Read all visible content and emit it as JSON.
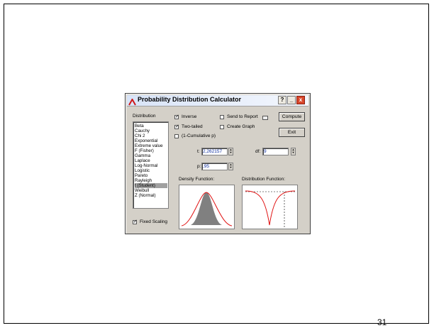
{
  "window": {
    "title": "Probability Distribution Calculator",
    "help": "?",
    "minimize": "_",
    "close": "x"
  },
  "distribution": {
    "label": "Distribution",
    "items": [
      "Beta",
      "Cauchy",
      "Chi 2",
      "Exponential",
      "Extreme value",
      "F (Fisher)",
      "Gamma",
      "Laplace",
      "Log-Normal",
      "Logistic",
      "Pareto",
      "Rayleigh",
      "t (Student)",
      "Weibull",
      "Z (Normal)"
    ],
    "selected": "t (Student)"
  },
  "options": {
    "inverse": {
      "label": "Inverse",
      "checked": true
    },
    "two_tailed": {
      "label": "Two-tailed",
      "checked": true
    },
    "cumulative": {
      "label": "(1-Cumulative p)",
      "checked": false
    },
    "send_to_report": {
      "label": "Send to Report",
      "checked": false
    },
    "create_graph": {
      "label": "Create Graph",
      "checked": false
    },
    "fixed_scaling": {
      "label": "Fixed Scaling",
      "checked": true
    }
  },
  "buttons": {
    "compute": "Compute",
    "exit": "Exit"
  },
  "fields": {
    "t": {
      "label": "t:",
      "value": "2,262157"
    },
    "df": {
      "label": "df:",
      "value": "9"
    },
    "p": {
      "label": "p:",
      "value": ",95"
    }
  },
  "plots": {
    "density_label": "Density Function:",
    "distribution_label": "Distribution Function:"
  },
  "slide_number": "31",
  "colors": {
    "curve": "#e01010",
    "fill": "#808080"
  }
}
